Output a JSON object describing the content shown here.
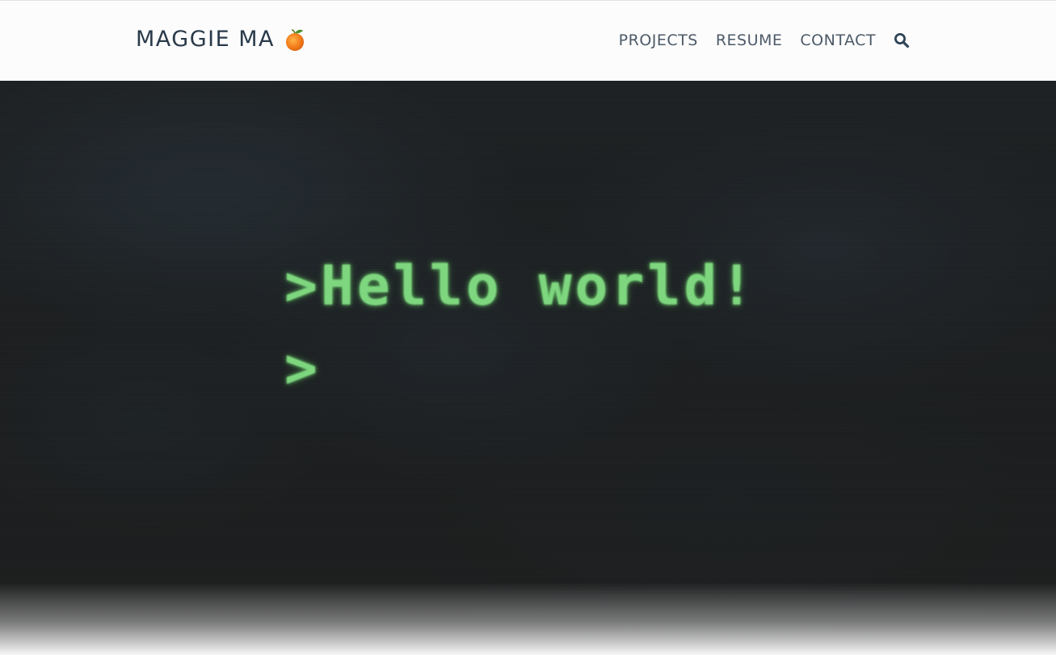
{
  "header": {
    "brand_text": "MAGGIE MA",
    "brand_icon": "orange-emoji-icon",
    "nav": [
      {
        "label": "PROJECTS"
      },
      {
        "label": "RESUME"
      },
      {
        "label": "CONTACT"
      }
    ],
    "search_icon": "search-icon"
  },
  "hero": {
    "line_1": ">Hello world!",
    "line_2": ">",
    "text_color": "#7ed67f",
    "background_color": "#1c1e1f"
  }
}
